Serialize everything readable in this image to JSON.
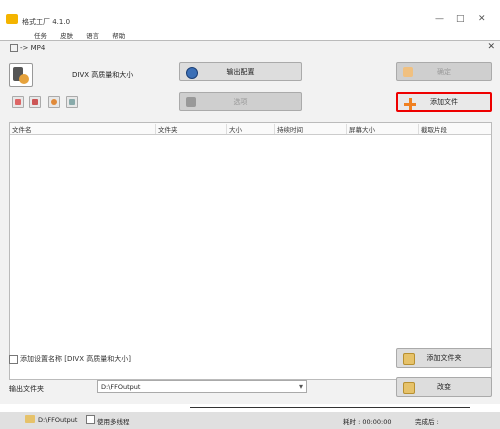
{
  "app": {
    "title": "格式工厂 4.1.0",
    "menu": [
      "任务",
      "皮肤",
      "语言",
      "帮助"
    ],
    "window_controls": {
      "minimize": "—",
      "maximize": "□",
      "close": "✕"
    }
  },
  "dialog": {
    "title": "-> MP4",
    "close": "✕",
    "format_label": "DIVX 高质量和大小",
    "output_config_button": "输出配置",
    "options_button": "选项",
    "ok_button": "确定",
    "add_file_button": "添加文件",
    "table_headers": [
      "文件名",
      "文件夹",
      "大小",
      "持续时间",
      "屏幕大小",
      "截取片段"
    ],
    "add_setting_name_label": "添加设置名称",
    "add_setting_name_value": "[DIVX 高质量和大小]",
    "add_folder_button": "添加文件夹",
    "change_button": "改变",
    "output_folder_label": "输出文件夹",
    "output_folder_value": "D:\\FFOutput",
    "dropdown_icon": "▾"
  },
  "taskbar": {
    "path": "D:\\FFOutput",
    "multithread_label": "使用多线程",
    "elapsed": "耗时 : 00:00:00",
    "after": "完成后 :"
  },
  "colors": {
    "highlight_border": "#e00000",
    "accent_orange": "#f08020"
  }
}
